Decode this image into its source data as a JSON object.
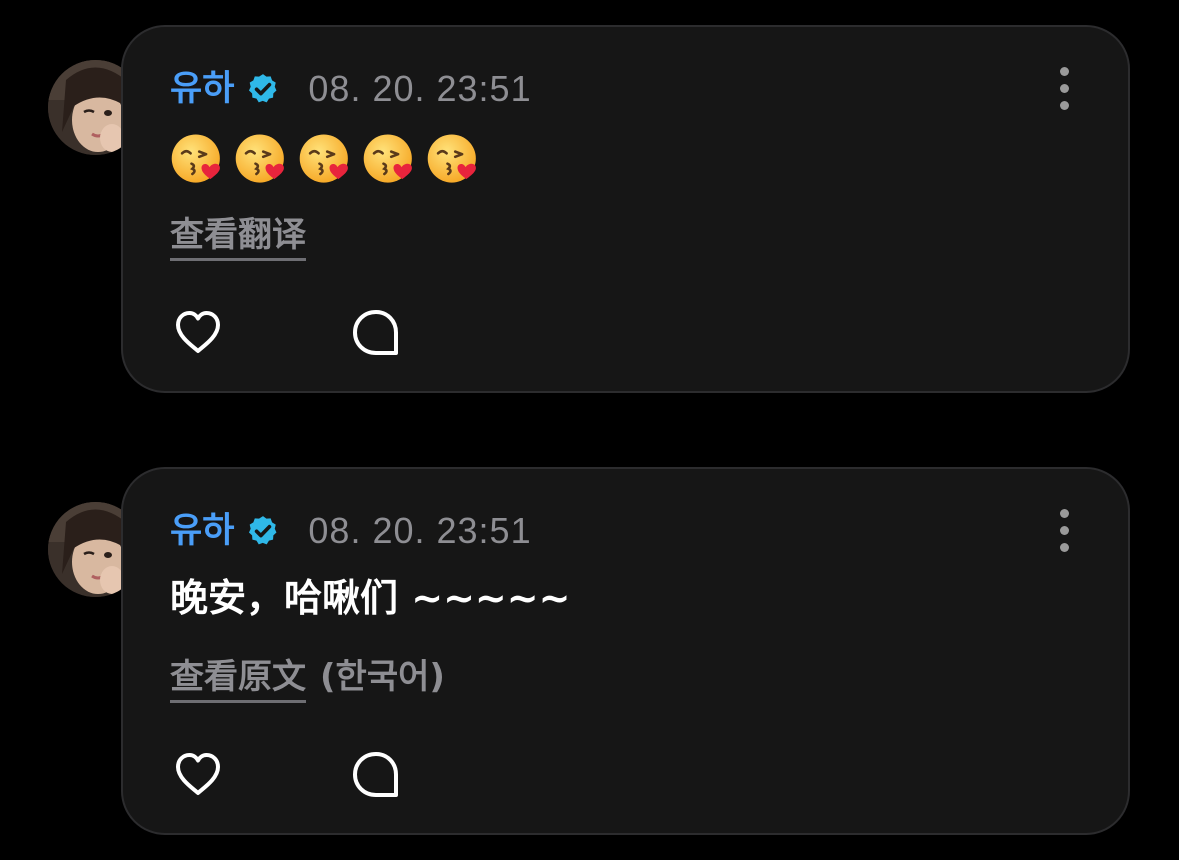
{
  "posts": [
    {
      "author": "유하",
      "verified_icon": "verified-badge-icon",
      "timestamp": "08. 20. 23:51",
      "content_type": "emoji",
      "content_text": "",
      "emojis": [
        "😘",
        "😘",
        "😘",
        "😘",
        "😘"
      ],
      "translate_link": "查看翻译",
      "lang_note": "",
      "actions": [
        "heart-icon",
        "comment-icon"
      ],
      "more_icon": "more-vertical-icon"
    },
    {
      "author": "유하",
      "verified_icon": "verified-badge-icon",
      "timestamp": "08. 20. 23:51",
      "content_type": "text",
      "content_text": "晚安，哈啾们 ~~~~~",
      "emojis": [],
      "translate_link": "查看原文",
      "lang_note": "(한국어)",
      "actions": [
        "heart-icon",
        "comment-icon"
      ],
      "more_icon": "more-vertical-icon"
    }
  ],
  "colors": {
    "background": "#000000",
    "card": "#161616",
    "card_border": "#2c2c2e",
    "username": "#4a9ef8",
    "verified": "#2fb8e8",
    "secondary_text": "#8e8e93",
    "primary_text": "#ffffff"
  }
}
